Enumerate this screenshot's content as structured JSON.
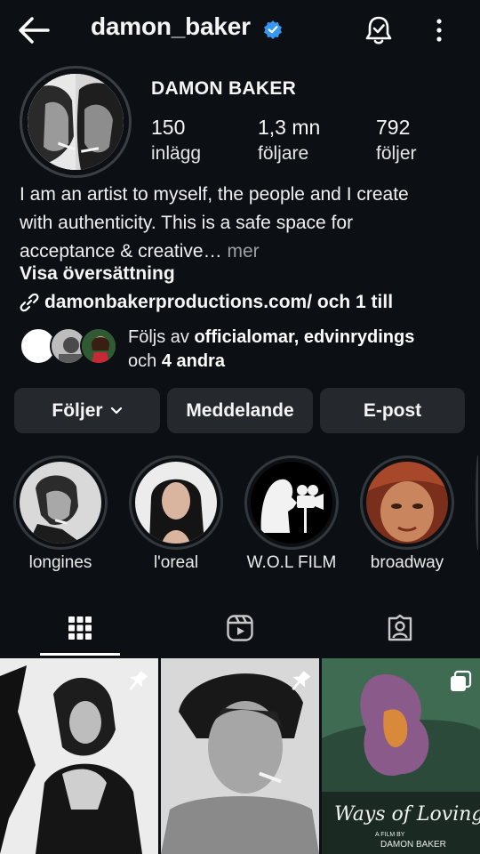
{
  "header": {
    "username": "damon_baker",
    "icons": {
      "back": "back-arrow-icon",
      "verified": "verified-badge-icon",
      "notifications": "bell-check-icon",
      "more": "more-vertical-icon"
    }
  },
  "profile": {
    "full_name": "DAMON BAKER",
    "stats": [
      {
        "value": "150",
        "label": "inlägg"
      },
      {
        "value": "1,3 mn",
        "label": "följare"
      },
      {
        "value": "792",
        "label": "följer"
      }
    ],
    "bio_line1": "I am an artist to myself, the people and I create",
    "bio_line2": "with authenticity. This is a safe space for",
    "bio_line3": "acceptance & creative…",
    "bio_more": " mer",
    "translate": "Visa översättning",
    "link": "damonbakerproductions.com/ och 1 till",
    "followed_prefix": "Följs av ",
    "followed_names": "officialomar, edvinrydings",
    "followed_suffix_pre": "och ",
    "followed_suffix": "4 andra"
  },
  "actions": {
    "follow": "Följer",
    "message": "Meddelande",
    "email": "E-post"
  },
  "highlights": [
    {
      "label": "longines"
    },
    {
      "label": "l'oreal"
    },
    {
      "label": "W.O.L FILM"
    },
    {
      "label": "broadway"
    }
  ],
  "tabs": {
    "icons": [
      "grid-icon",
      "reels-icon",
      "tagged-icon"
    ]
  },
  "posts": {
    "poster_title": "Ways of Loving",
    "poster_credit": "A FILM BY",
    "poster_director": "DAMON BAKER"
  },
  "colors": {
    "background": "#0c1014",
    "button": "#25292e",
    "verified": "#3897f0",
    "muted": "#9aa0a6"
  }
}
